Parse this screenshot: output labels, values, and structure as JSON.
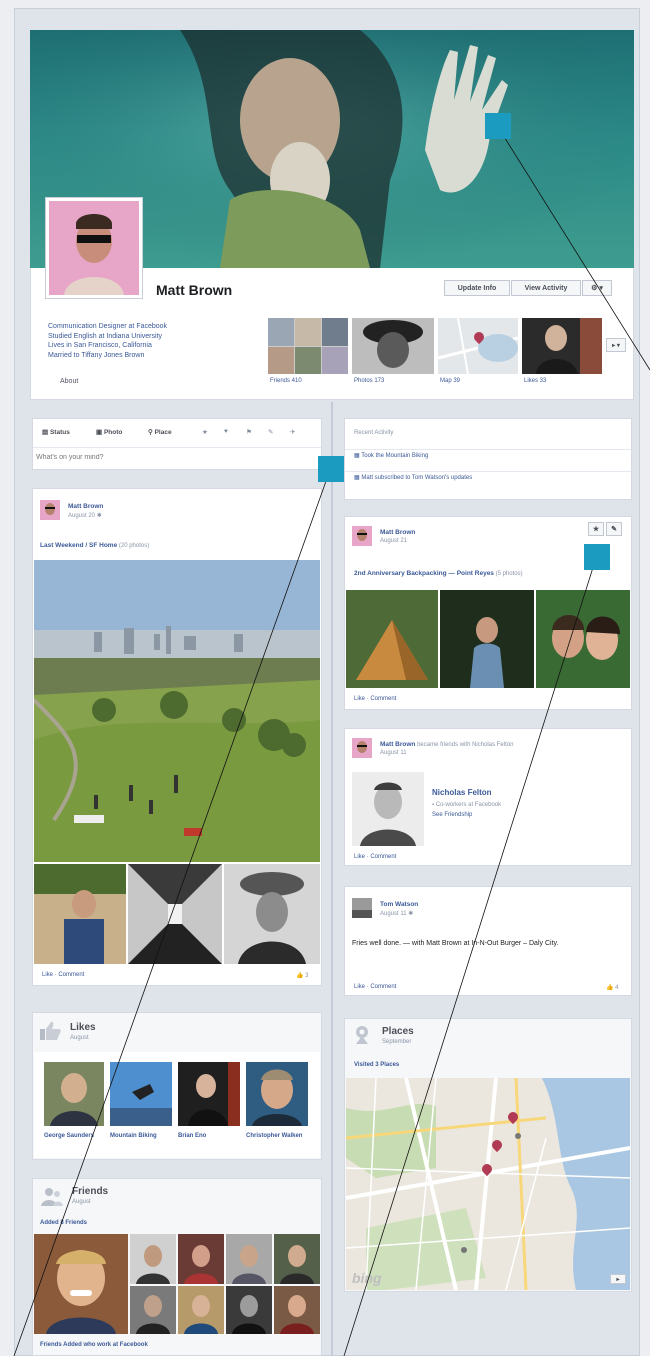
{
  "profile": {
    "name": "Matt Brown",
    "update_info": "Update Info",
    "view_activity": "View Activity",
    "gear": "⚙ ▾",
    "about_lines": [
      "Communication Designer at Facebook",
      "Studied English at Indiana University",
      "Lives in San Francisco, California",
      "Married to Tiffany Jones Brown"
    ],
    "about_label": "About",
    "tiles": [
      {
        "label": "Friends 410"
      },
      {
        "label": "Photos 173"
      },
      {
        "label": "Map 39"
      },
      {
        "label": "Likes 33"
      }
    ],
    "tiles_more": "▸ ▾"
  },
  "composer": {
    "tabs": [
      "Status",
      "Photo",
      "Place"
    ],
    "placeholder": "What's on your mind?",
    "extra_icons": [
      "★",
      "♥",
      "⚑",
      "✎",
      "✈"
    ]
  },
  "recent_activity": {
    "title": "Recent Activity",
    "items": [
      "Took the Mountain Biking",
      "Matt subscribed to Tom Watson's updates"
    ]
  },
  "post_album": {
    "author": "Matt Brown",
    "date": "August 20 ✱",
    "caption_link": "Last Weekend / SF Home",
    "caption_rest": "(20 photos)",
    "actions": "Like · Comment",
    "likes": "👍 3"
  },
  "post_backpacking": {
    "author": "Matt Brown",
    "date": "August 21",
    "caption_link": "2nd Anniversary Backpacking — Point Reyes",
    "caption_rest": "(5 photos)",
    "actions": "Like · Comment",
    "star_icon": "★",
    "pencil_icon": "✎"
  },
  "post_friends": {
    "author": "Matt Brown",
    "action_text": "became friends with Nicholas Felton",
    "date": "August 11",
    "friend_name": "Nicholas Felton",
    "friend_line1": "▪ Co-workers at Facebook",
    "friend_line2": "See Friendship",
    "actions": "Like · Comment"
  },
  "post_tom": {
    "author": "Tom Watson",
    "date": "August 11 ✱",
    "text": "Fries well done. — with Matt Brown at In-N-Out Burger – Daly City.",
    "actions": "Like · Comment",
    "likes": "👍 4"
  },
  "likes_box": {
    "title": "Likes",
    "subtitle": "August",
    "items": [
      {
        "name": "George Saunders"
      },
      {
        "name": "Mountain Biking"
      },
      {
        "name": "Brian Eno"
      },
      {
        "name": "Christopher Walken"
      }
    ]
  },
  "places_box": {
    "title": "Places",
    "subtitle": "September",
    "visited": "Visited 3 Places",
    "map_brand": "bing"
  },
  "friends_box": {
    "title": "Friends",
    "subtitle": "August",
    "added": "Added 8 Friends",
    "footer": "Friends Added who work at Facebook"
  },
  "colors": {
    "link": "#3b5998",
    "marker": "#1a9bbf",
    "pin": "#b13b55"
  }
}
